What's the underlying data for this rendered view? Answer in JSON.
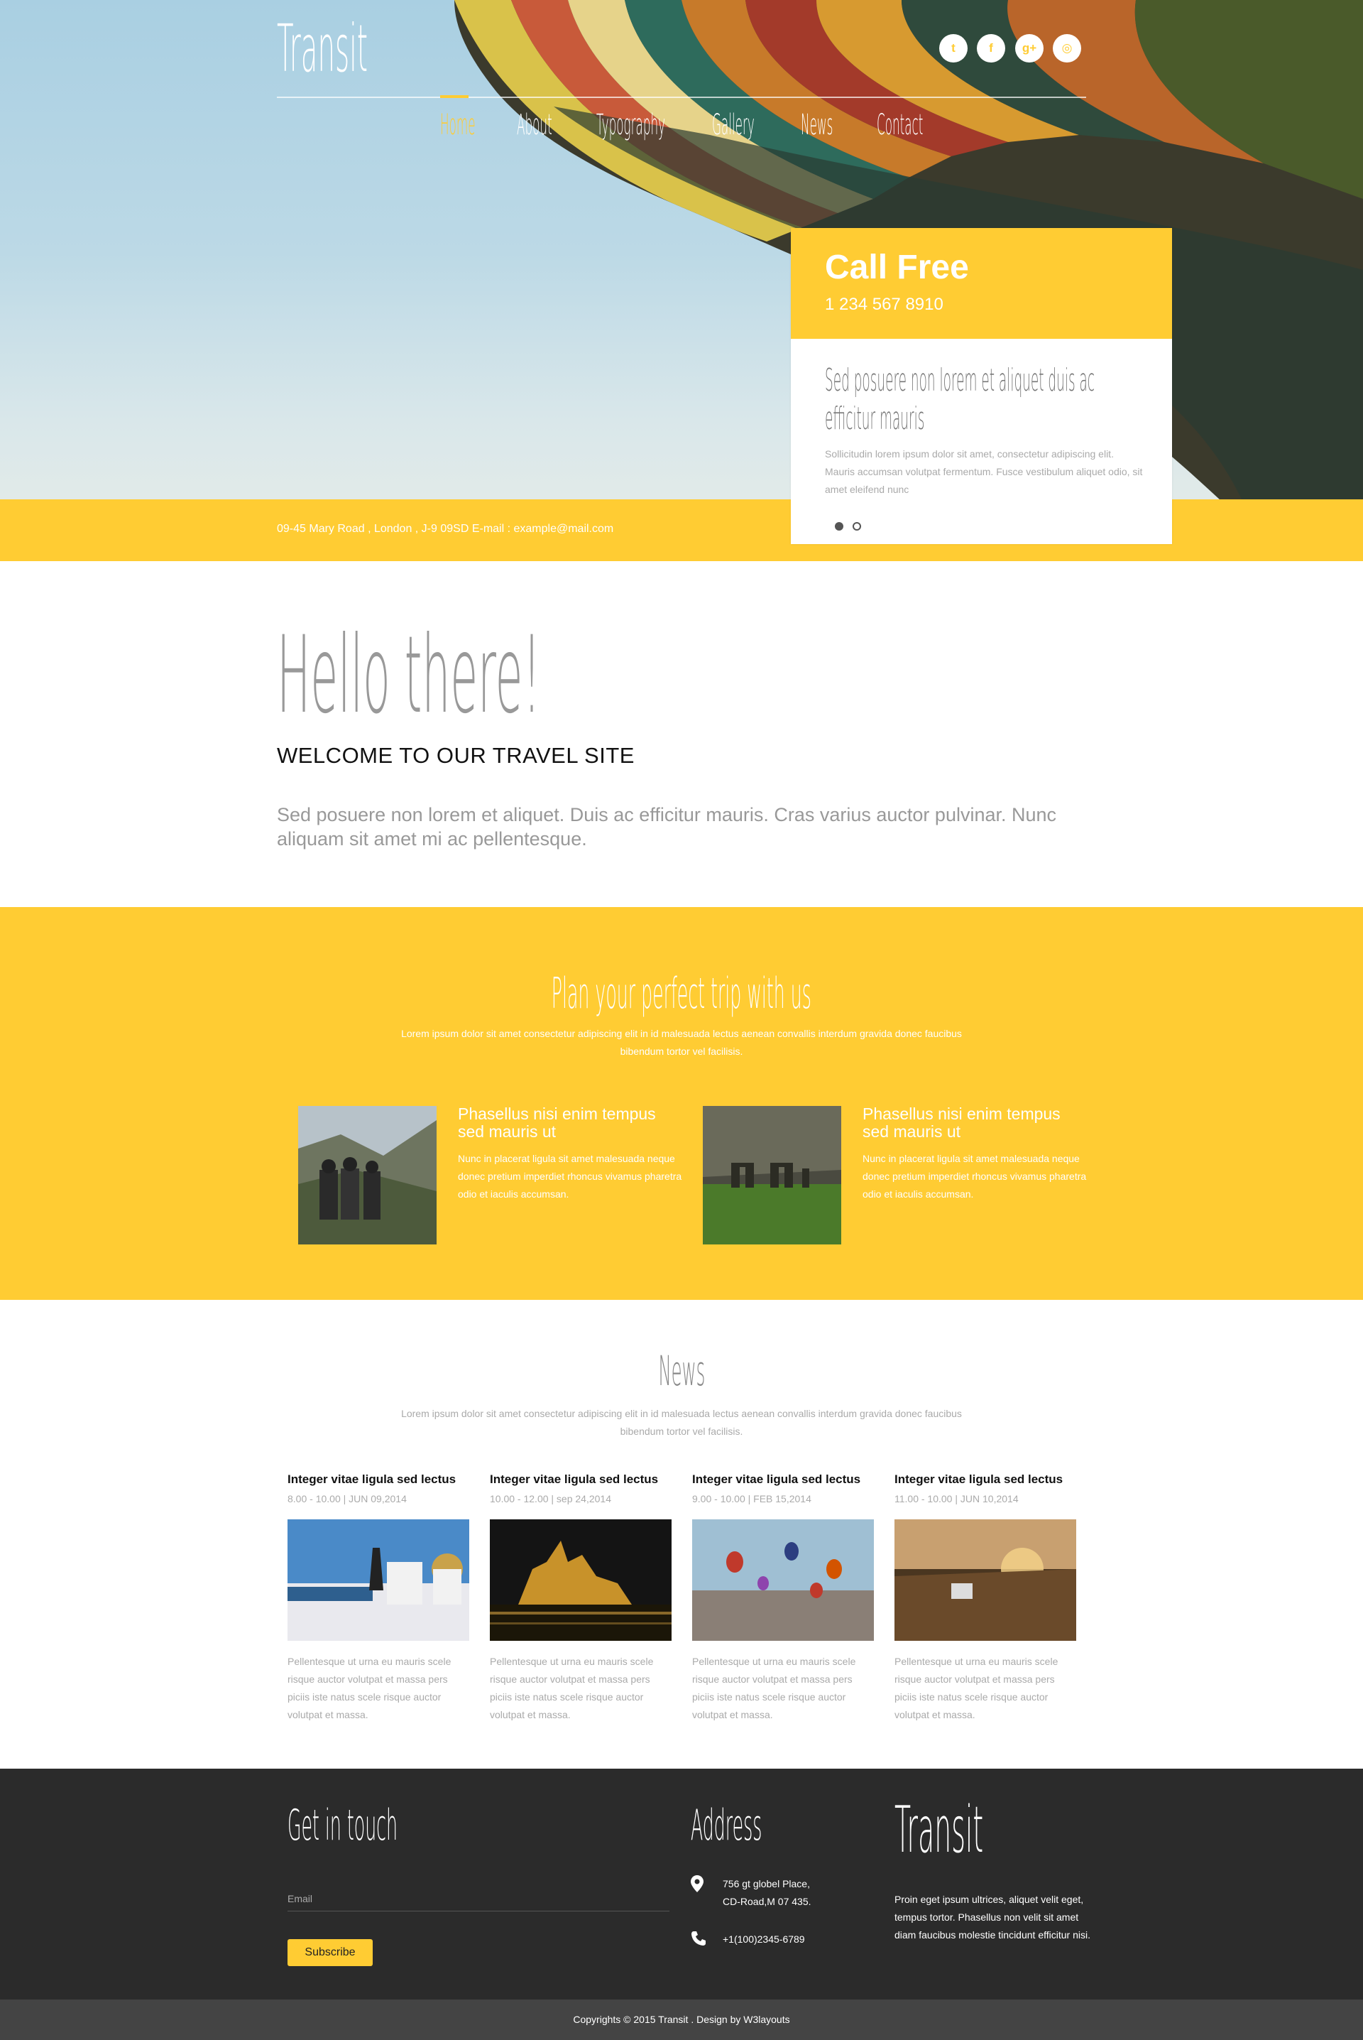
{
  "brand": {
    "logo": "Transit",
    "accent": "#ffcc33"
  },
  "social": [
    {
      "name": "twitter-icon",
      "glyph": "t"
    },
    {
      "name": "facebook-icon",
      "glyph": "f"
    },
    {
      "name": "google-plus-icon",
      "glyph": "g+"
    },
    {
      "name": "dribbble-icon",
      "glyph": "◎"
    }
  ],
  "nav": [
    "Home",
    "About",
    "Typography",
    "Gallery",
    "News",
    "Contact"
  ],
  "hero": {
    "call_title": "Call Free",
    "call_phone": "1 234 567 8910",
    "slide_heading_line1": "Sed posuere non lorem et aliquet duis ac",
    "slide_heading_line2": "efficitur mauris",
    "slide_text": "Sollicitudin lorem ipsum dolor sit amet, consectetur adipiscing elit. Mauris accumsan volutpat fermentum. Fusce vestibulum aliquet odio, sit amet eleifend nunc",
    "address": "09-45 Mary Road , London , J-9 09SD E-mail : example@mail.com"
  },
  "welcome": {
    "hello": "Hello there!",
    "title": "WELCOME TO OUR TRAVEL SITE",
    "text": "Sed posuere non lorem et aliquet. Duis ac efficitur mauris. Cras varius auctor pulvinar. Nunc aliquam sit amet mi ac pellentesque."
  },
  "plan": {
    "title": "Plan your perfect trip with us",
    "intro": "Lorem ipsum dolor sit amet consectetur adipiscing elit in id malesuada lectus aenean convallis interdum gravida donec faucibus bibendum tortor vel facilisis.",
    "features": [
      {
        "title": "Phasellus nisi enim tempus sed mauris ut",
        "text": "Nunc in placerat ligula sit amet malesuada neque donec pretium imperdiet rhoncus vivamus pharetra odio et iaculis accumsan."
      },
      {
        "title": "Phasellus nisi enim tempus sed mauris ut",
        "text": "Nunc in placerat ligula sit amet malesuada neque donec pretium imperdiet rhoncus vivamus pharetra odio et iaculis accumsan."
      }
    ]
  },
  "news": {
    "title": "News",
    "intro": "Lorem ipsum dolor sit amet consectetur adipiscing elit in id malesuada lectus aenean convallis interdum gravida donec faucibus bibendum tortor vel facilisis.",
    "items": [
      {
        "title": "Integer vitae ligula sed lectus",
        "date": "8.00 - 10.00 | JUN 09,2014",
        "text": "Pellentesque ut urna eu mauris scele risque auctor volutpat et massa pers piciis iste natus scele risque auctor volutpat et massa."
      },
      {
        "title": "Integer vitae ligula sed lectus",
        "date": "10.00 - 12.00 | sep 24,2014",
        "text": "Pellentesque ut urna eu mauris scele risque auctor volutpat et massa pers piciis iste natus scele risque auctor volutpat et massa."
      },
      {
        "title": "Integer vitae ligula sed lectus",
        "date": "9.00 - 10.00 | FEB 15,2014",
        "text": "Pellentesque ut urna eu mauris scele risque auctor volutpat et massa pers piciis iste natus scele risque auctor volutpat et massa."
      },
      {
        "title": "Integer vitae ligula sed lectus",
        "date": "11.00 - 10.00 | JUN 10,2014",
        "text": "Pellentesque ut urna eu mauris scele risque auctor volutpat et massa pers piciis iste natus scele risque auctor volutpat et massa."
      }
    ]
  },
  "footer": {
    "touch_title": "Get in touch",
    "email_placeholder": "Email",
    "subscribe": "Subscribe",
    "address_title": "Address",
    "address_line1": "756 gt globel Place,",
    "address_line2": "CD-Road,M 07 435.",
    "phone": "+1(100)2345-6789",
    "logo": "Transit",
    "about": "Proin eget ipsum ultrices, aliquet velit eget, tempus tortor. Phasellus non velit sit amet diam faucibus molestie tincidunt efficitur nisi."
  },
  "copyright": "Copyrights © 2015 Transit . Design by W3layouts"
}
